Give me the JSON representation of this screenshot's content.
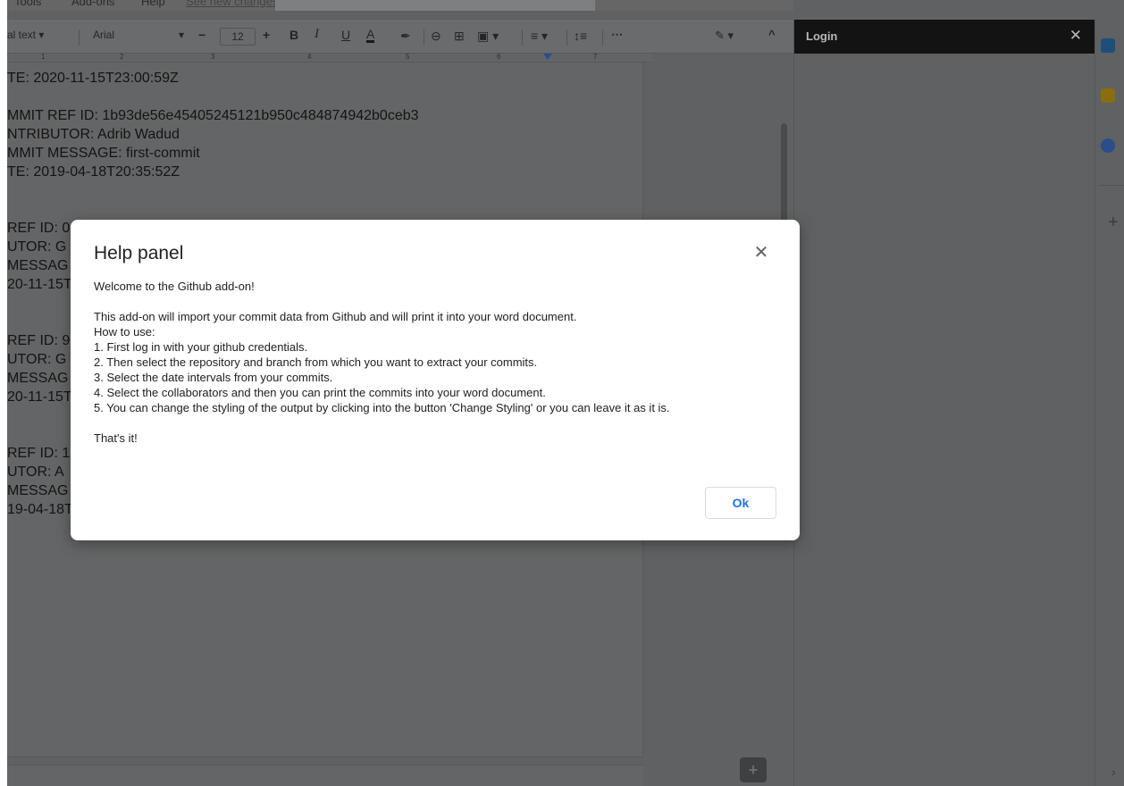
{
  "menubar": {
    "items": [
      "Tools",
      "Add-ons",
      "Help",
      "See new changes"
    ]
  },
  "toolbar": {
    "style_select": "al text",
    "font_select": "Arial",
    "font_size": "12",
    "minus": "−",
    "plus": "+",
    "bold": "B",
    "italic": "I",
    "underline": "U",
    "text_color": "A",
    "more": "⋯",
    "edit_mode": "✎ ▾",
    "collapse": "^"
  },
  "ruler": {
    "labels": [
      "1",
      "2",
      "3",
      "4",
      "5",
      "6",
      "7"
    ]
  },
  "document": {
    "lines": [
      "TE: 2020-11-15T23:00:59Z",
      "",
      "MMIT REF ID: 1b93de56e45405245121b950c484874942b0ceb3",
      "NTRIBUTOR:  Adrib Wadud",
      "MMIT MESSAGE: first-commit",
      "TE: 2019-04-18T20:35:52Z",
      "",
      "",
      "REF ID: 0",
      "UTOR:  G",
      "MESSAG",
      "20-11-15T",
      "",
      "",
      "REF ID: 9",
      "UTOR:  G",
      "MESSAG",
      "20-11-15T",
      "",
      "",
      "REF ID: 1",
      "UTOR:  A",
      "MESSAG",
      "19-04-18T"
    ]
  },
  "side_panel": {
    "title": "Login",
    "close": "✕"
  },
  "rail": {
    "plus": "+",
    "expand": "›"
  },
  "help_modal": {
    "title": "Help panel",
    "close": "✕",
    "welcome": "Welcome to the Github add-on!",
    "intro": "This add-on will import your commit data from Github and will print it into your word document.",
    "how_to": "How to use:",
    "steps": [
      "1. First log in with your github credentials.",
      "2. Then select the repository and branch from which you want to extract your commits.",
      "3. Select the date intervals from your commits.",
      "4. Select the collaborators and then you can print the commits into your word document.",
      "5. You can change the styling of the output by clicking into the button 'Change Styling' or you can leave it as it is."
    ],
    "outro": "That's it!",
    "ok_label": "Ok"
  },
  "colors": {
    "dim_overlay": "#5f6163",
    "modal_bg": "#ffffff",
    "ok_text": "#1a73e8",
    "panel_header": "#131313"
  }
}
